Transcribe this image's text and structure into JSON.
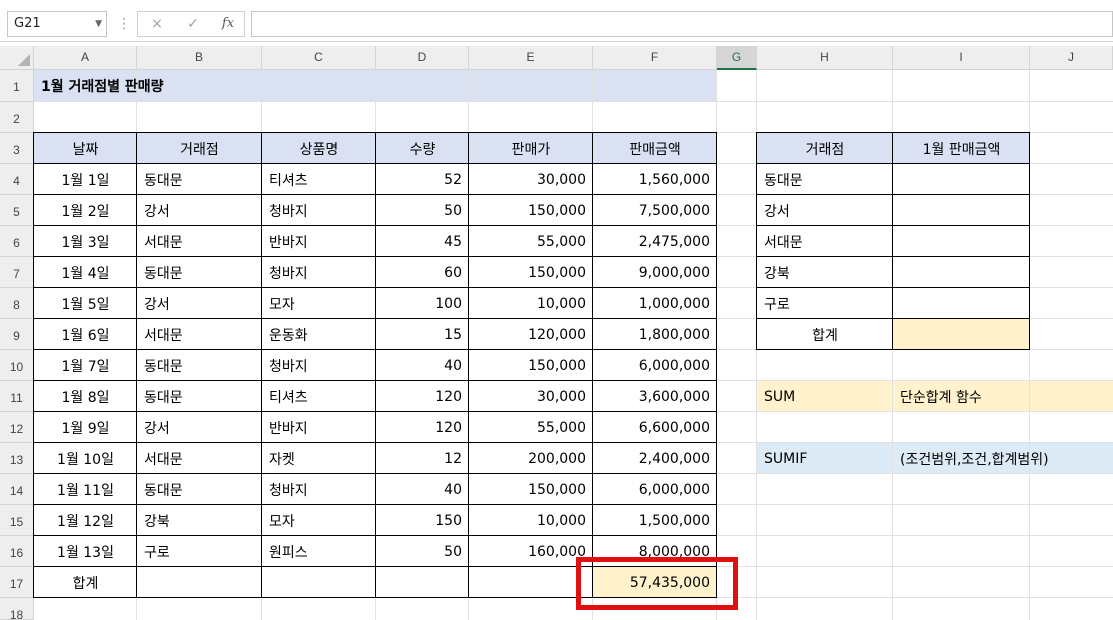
{
  "formula_bar": {
    "name_box": "G21",
    "cancel_icon": "×",
    "enter_icon": "✓",
    "fx_icon": "fx",
    "separator": "⋮",
    "formula": ""
  },
  "columns": [
    "A",
    "B",
    "C",
    "D",
    "E",
    "F",
    "G",
    "H",
    "I",
    "J"
  ],
  "rows": [
    "1",
    "2",
    "3",
    "4",
    "5",
    "6",
    "7",
    "8",
    "9",
    "10",
    "11",
    "12",
    "13",
    "14",
    "15",
    "16",
    "17",
    "18"
  ],
  "selected_column": "G",
  "sheet": {
    "title": "1월 거래점별 판매량",
    "headers": [
      "날짜",
      "거래점",
      "상품명",
      "수량",
      "판매가",
      "판매금액"
    ],
    "data": [
      [
        "1월 1일",
        "동대문",
        "티셔츠",
        "52",
        "30,000",
        "1,560,000"
      ],
      [
        "1월 2일",
        "강서",
        "청바지",
        "50",
        "150,000",
        "7,500,000"
      ],
      [
        "1월 3일",
        "서대문",
        "반바지",
        "45",
        "55,000",
        "2,475,000"
      ],
      [
        "1월 4일",
        "동대문",
        "청바지",
        "60",
        "150,000",
        "9,000,000"
      ],
      [
        "1월 5일",
        "강서",
        "모자",
        "100",
        "10,000",
        "1,000,000"
      ],
      [
        "1월 6일",
        "서대문",
        "운동화",
        "15",
        "120,000",
        "1,800,000"
      ],
      [
        "1월 7일",
        "동대문",
        "청바지",
        "40",
        "150,000",
        "6,000,000"
      ],
      [
        "1월 8일",
        "동대문",
        "티셔츠",
        "120",
        "30,000",
        "3,600,000"
      ],
      [
        "1월 9일",
        "강서",
        "반바지",
        "120",
        "55,000",
        "6,600,000"
      ],
      [
        "1월 10일",
        "서대문",
        "자켓",
        "12",
        "200,000",
        "2,400,000"
      ],
      [
        "1월 11일",
        "동대문",
        "청바지",
        "40",
        "150,000",
        "6,000,000"
      ],
      [
        "1월 12일",
        "강북",
        "모자",
        "150",
        "10,000",
        "1,500,000"
      ],
      [
        "1월 13일",
        "구로",
        "원피스",
        "50",
        "160,000",
        "8,000,000"
      ]
    ],
    "total_label": "합계",
    "total_value": "57,435,000"
  },
  "summary": {
    "headers": [
      "거래점",
      "1월 판매금액"
    ],
    "stores": [
      "동대문",
      "강서",
      "서대문",
      "강북",
      "구로"
    ],
    "total_label": "합계"
  },
  "notes": {
    "sum_name": "SUM",
    "sum_desc": "단순합계 함수",
    "sumif_name": "SUMIF",
    "sumif_desc": "(조건범위,조건,합계범위)"
  },
  "colors": {
    "title_fill": "#d9e1f2",
    "header_fill": "#d9e1f2",
    "total_fill": "#fff2cc",
    "sum_fill": "#fff2cc",
    "sumif_fill": "#ddebf7",
    "highlight_border": "#e01010"
  }
}
